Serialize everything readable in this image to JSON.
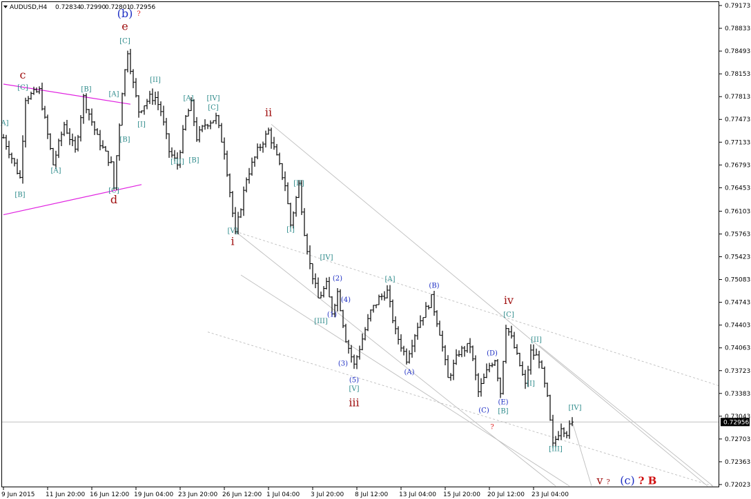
{
  "header": {
    "symbol_text": "AUDUSD,H4",
    "open": "0.72834",
    "high": "0.72990",
    "low": "0.72801",
    "close": "0.72956"
  },
  "chart_data": {
    "type": "ohlc-bar",
    "symbol": "AUDUSD",
    "timeframe": "H4",
    "current_price": 0.72956,
    "ylim": [
      0.72023,
      0.79173
    ],
    "y_ticks": [
      "0.79173",
      "0.78833",
      "0.78493",
      "0.78153",
      "0.77813",
      "0.77473",
      "0.77133",
      "0.76793",
      "0.76453",
      "0.76103",
      "0.75763",
      "0.75423",
      "0.75083",
      "0.74743",
      "0.74403",
      "0.74063",
      "0.73723",
      "0.73383",
      "0.73043",
      "0.72703",
      "0.72363",
      "0.72023"
    ],
    "x_ticks": [
      {
        "label": "9 Jun 2015",
        "bar": 0
      },
      {
        "label": "11 Jun 20:00",
        "bar": 16
      },
      {
        "label": "16 Jun 12:00",
        "bar": 32
      },
      {
        "label": "19 Jun 04:00",
        "bar": 48
      },
      {
        "label": "23 Jun 20:00",
        "bar": 64
      },
      {
        "label": "26 Jun 12:00",
        "bar": 80
      },
      {
        "label": "1 Jul 04:00",
        "bar": 96
      },
      {
        "label": "3 Jul 20:00",
        "bar": 112
      },
      {
        "label": "8 Jul 12:00",
        "bar": 128
      },
      {
        "label": "13 Jul 04:00",
        "bar": 144
      },
      {
        "label": "15 Jul 20:00",
        "bar": 160
      },
      {
        "label": "20 Jul 12:00",
        "bar": 176
      },
      {
        "label": "23 Jul 04:00",
        "bar": 192
      }
    ],
    "anchors": [
      [
        0,
        0.772
      ],
      [
        6,
        0.766
      ],
      [
        8,
        0.778
      ],
      [
        13,
        0.779
      ],
      [
        18,
        0.768
      ],
      [
        22,
        0.774
      ],
      [
        26,
        0.77
      ],
      [
        29,
        0.778
      ],
      [
        34,
        0.772
      ],
      [
        39,
        0.768
      ],
      [
        40,
        0.7645
      ],
      [
        43,
        0.779
      ],
      [
        45,
        0.785
      ],
      [
        47,
        0.78
      ],
      [
        49,
        0.776
      ],
      [
        53,
        0.778
      ],
      [
        55,
        0.778
      ],
      [
        57,
        0.776
      ],
      [
        60,
        0.77
      ],
      [
        63,
        0.768
      ],
      [
        66,
        0.775
      ],
      [
        68,
        0.777
      ],
      [
        70,
        0.772
      ],
      [
        73,
        0.774
      ],
      [
        77,
        0.775
      ],
      [
        80,
        0.77
      ],
      [
        82,
        0.764
      ],
      [
        84,
        0.7575
      ],
      [
        88,
        0.766
      ],
      [
        92,
        0.77
      ],
      [
        96,
        0.773
      ],
      [
        99,
        0.769
      ],
      [
        102,
        0.765
      ],
      [
        104,
        0.759
      ],
      [
        107,
        0.765
      ],
      [
        109,
        0.758
      ],
      [
        111,
        0.753
      ],
      [
        114,
        0.748
      ],
      [
        117,
        0.75
      ],
      [
        119,
        0.746
      ],
      [
        121,
        0.749
      ],
      [
        124,
        0.742
      ],
      [
        127,
        0.738
      ],
      [
        130,
        0.742
      ],
      [
        133,
        0.746
      ],
      [
        136,
        0.748
      ],
      [
        139,
        0.749
      ],
      [
        142,
        0.743
      ],
      [
        146,
        0.739
      ],
      [
        150,
        0.744
      ],
      [
        155,
        0.748
      ],
      [
        158,
        0.743
      ],
      [
        161,
        0.736
      ],
      [
        165,
        0.74
      ],
      [
        169,
        0.741
      ],
      [
        172,
        0.734
      ],
      [
        176,
        0.738
      ],
      [
        178,
        0.739
      ],
      [
        180,
        0.734
      ],
      [
        182,
        0.744
      ],
      [
        184,
        0.742
      ],
      [
        187,
        0.738
      ],
      [
        189,
        0.735
      ],
      [
        191,
        0.74
      ],
      [
        194,
        0.739
      ],
      [
        197,
        0.733
      ],
      [
        199,
        0.726
      ],
      [
        202,
        0.729
      ],
      [
        204,
        0.728
      ],
      [
        206,
        0.7296
      ]
    ],
    "noise": 0.0012,
    "trend_lines": [
      {
        "style": "magenta",
        "points": [
          [
            0,
            0.78
          ],
          [
            46,
            0.777
          ]
        ]
      },
      {
        "style": "magenta",
        "points": [
          [
            0,
            0.7605
          ],
          [
            50,
            0.765
          ]
        ]
      },
      {
        "style": "gray-solid",
        "points": [
          [
            97,
            0.774
          ],
          [
            255,
            0.72
          ]
        ]
      },
      {
        "style": "gray-solid",
        "points": [
          [
            84,
            0.758
          ],
          [
            200,
            0.72
          ]
        ]
      },
      {
        "style": "gray-solid",
        "points": [
          [
            86,
            0.7515
          ],
          [
            205,
            0.72
          ]
        ]
      },
      {
        "style": "gray-dash",
        "points": [
          [
            84,
            0.758
          ],
          [
            259,
            0.735
          ]
        ]
      },
      {
        "style": "gray-dash",
        "points": [
          [
            74,
            0.743
          ],
          [
            257,
            0.72
          ]
        ]
      },
      {
        "style": "gray-solid",
        "points": [
          [
            194,
            0.741
          ],
          [
            257,
            0.72
          ]
        ]
      },
      {
        "style": "gray-solid",
        "points": [
          [
            206,
            0.7296
          ],
          [
            213,
            0.72
          ]
        ]
      }
    ],
    "wave_labels": [
      {
        "text": "[A]",
        "bar": 0,
        "price": 0.7739,
        "color": "teal"
      },
      {
        "text": "[B]",
        "bar": 6,
        "price": 0.7632,
        "color": "teal"
      },
      {
        "text": "c",
        "bar": 7,
        "price": 0.7808,
        "color": "darkred"
      },
      {
        "text": "[C]",
        "bar": 7,
        "price": 0.7792,
        "color": "teal"
      },
      {
        "text": "[A]",
        "bar": 19,
        "price": 0.7668,
        "color": "teal"
      },
      {
        "text": "[B]",
        "bar": 30,
        "price": 0.7789,
        "color": "teal"
      },
      {
        "text": "[A]",
        "bar": 40,
        "price": 0.7782,
        "color": "teal"
      },
      {
        "text": "[B]",
        "bar": 44,
        "price": 0.7714,
        "color": "teal"
      },
      {
        "text": "[C]",
        "bar": 40,
        "price": 0.7638,
        "color": "teal"
      },
      {
        "text": "d",
        "bar": 40,
        "price": 0.7622,
        "color": "darkred"
      },
      {
        "text": "(b)",
        "bar": 44,
        "price": 0.79,
        "color": "navy"
      },
      {
        "text": "?",
        "bar": 49,
        "price": 0.7902,
        "color": "red"
      },
      {
        "text": "e",
        "bar": 44,
        "price": 0.7881,
        "color": "darkred"
      },
      {
        "text": "[C]",
        "bar": 44,
        "price": 0.7861,
        "color": "teal"
      },
      {
        "text": "[II]",
        "bar": 55,
        "price": 0.7803,
        "color": "teal"
      },
      {
        "text": "[I]",
        "bar": 50,
        "price": 0.7737,
        "color": "teal"
      },
      {
        "text": "[III]",
        "bar": 63,
        "price": 0.7681,
        "color": "teal"
      },
      {
        "text": "[A]",
        "bar": 67,
        "price": 0.7776,
        "color": "teal"
      },
      {
        "text": "[B]",
        "bar": 69,
        "price": 0.7683,
        "color": "teal"
      },
      {
        "text": "[IV]",
        "bar": 76,
        "price": 0.7776,
        "color": "teal"
      },
      {
        "text": "[C]",
        "bar": 76,
        "price": 0.7762,
        "color": "teal"
      },
      {
        "text": "ii",
        "bar": 96,
        "price": 0.7752,
        "color": "darkred"
      },
      {
        "text": "[V]",
        "bar": 83,
        "price": 0.7578,
        "color": "teal"
      },
      {
        "text": "i",
        "bar": 83,
        "price": 0.756,
        "color": "darkred"
      },
      {
        "text": "[II]",
        "bar": 107,
        "price": 0.7649,
        "color": "teal"
      },
      {
        "text": "[I]",
        "bar": 104,
        "price": 0.758,
        "color": "teal"
      },
      {
        "text": "[IV]",
        "bar": 117,
        "price": 0.7538,
        "color": "teal"
      },
      {
        "text": "(2)",
        "bar": 121,
        "price": 0.7507,
        "color": "navy"
      },
      {
        "text": "(4)",
        "bar": 124,
        "price": 0.7475,
        "color": "navy"
      },
      {
        "text": "(1)",
        "bar": 119,
        "price": 0.7453,
        "color": "navy"
      },
      {
        "text": "[III]",
        "bar": 115,
        "price": 0.7443,
        "color": "teal"
      },
      {
        "text": "(3)",
        "bar": 123,
        "price": 0.738,
        "color": "navy"
      },
      {
        "text": "(5)",
        "bar": 127,
        "price": 0.7355,
        "color": "navy"
      },
      {
        "text": "[V]",
        "bar": 127,
        "price": 0.7342,
        "color": "teal"
      },
      {
        "text": "iii",
        "bar": 127,
        "price": 0.7319,
        "color": "darkred"
      },
      {
        "text": "[A]",
        "bar": 140,
        "price": 0.7506,
        "color": "teal"
      },
      {
        "text": "(A)",
        "bar": 147,
        "price": 0.7367,
        "color": "navy"
      },
      {
        "text": "(B)",
        "bar": 156,
        "price": 0.7496,
        "color": "navy"
      },
      {
        "text": "(C)",
        "bar": 174,
        "price": 0.731,
        "color": "navy"
      },
      {
        "text": "?",
        "bar": 177,
        "price": 0.7285,
        "color": "red"
      },
      {
        "text": "(D)",
        "bar": 177,
        "price": 0.7395,
        "color": "navy"
      },
      {
        "text": "(E)",
        "bar": 181,
        "price": 0.7322,
        "color": "navy"
      },
      {
        "text": "[B]",
        "bar": 181,
        "price": 0.7309,
        "color": "teal"
      },
      {
        "text": "iv",
        "bar": 183,
        "price": 0.7472,
        "color": "darkred"
      },
      {
        "text": "[C]",
        "bar": 183,
        "price": 0.7453,
        "color": "teal"
      },
      {
        "text": "[II]",
        "bar": 193,
        "price": 0.7415,
        "color": "teal"
      },
      {
        "text": "[I]",
        "bar": 191,
        "price": 0.735,
        "color": "teal"
      },
      {
        "text": "[IV]",
        "bar": 207,
        "price": 0.7314,
        "color": "teal"
      },
      {
        "text": "[III]",
        "bar": 200,
        "price": 0.7252,
        "color": "teal"
      },
      {
        "text": "v",
        "bar": 216,
        "price": 0.7203,
        "color": "darkred"
      },
      {
        "text": "?",
        "bar": 219,
        "price": 0.7203,
        "color": "darkred"
      },
      {
        "text": "(c)",
        "bar": 226,
        "price": 0.7203,
        "color": "navy"
      },
      {
        "text": "?",
        "bar": 231,
        "price": 0.7203,
        "color": "red-bold"
      },
      {
        "text": "B",
        "bar": 235,
        "price": 0.7203,
        "color": "red-bold"
      }
    ]
  },
  "colors": {
    "bar": "#000000",
    "teal": "#2e8b8b",
    "navy": "#1d2ec4",
    "darkred": "#a01010",
    "red": "#e02020",
    "red-bold": "#d01010",
    "magenta": "#e020e0",
    "trend": "#bdbdbd",
    "price_line": "#c0c0c0",
    "price_box": "#000000",
    "axis": "#000000"
  }
}
